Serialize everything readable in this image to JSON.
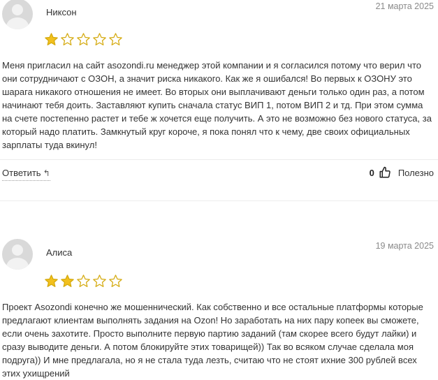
{
  "reviews": [
    {
      "author": "Никсон",
      "date": "21 марта 2025",
      "rating": 1,
      "text": "Меня пригласил на сайт asozondi.ru менеджер этой компании и я согласился потому что верил что они сотрудничают с ОЗОН, а значит риска никакого. Как же я ошибался! Во первых к ОЗОНУ это шарага никакого отношения не имеет. Во вторых они выплачивают деньги только один раз, а потом начинают тебя доить. Заставляют купить сначала статус ВИП 1, потом ВИП 2 и тд. При этом сумма на счете постепенно растет и тебе ж хочется еще получить. А это не возможно без нового статуса, за который надо платить. Замкнутый круг короче, я пока понял что к чему, две своих официальных зарплаты туда вкинул!",
      "reply_label": "Ответить",
      "reply_icon": "↰",
      "useful_count": "0",
      "useful_label": "Полезно"
    },
    {
      "author": "Алиса",
      "date": "19 марта 2025",
      "rating": 2,
      "text": "Проект Asozondi конечно же мошеннический. Как собственно и все остальные платформы которые предлагают клиентам выполнять задания на Ozon! Но заработать на них пару копеек вы сможете, если очень захотите. Просто выполните первую партию заданий (там скорее всего будут лайки) и сразу выводите деньги. А потом блокируйте этих товарищей)) Так во всяком случае сделала моя подруга)) И мне предлагала, но я не стала туда лезть, считаю что не стоят ихние 300 рублей всех этих ухищрений"
    }
  ],
  "colors": {
    "star_filled": "#f2c01e",
    "star_outline": "#d4a90c"
  }
}
